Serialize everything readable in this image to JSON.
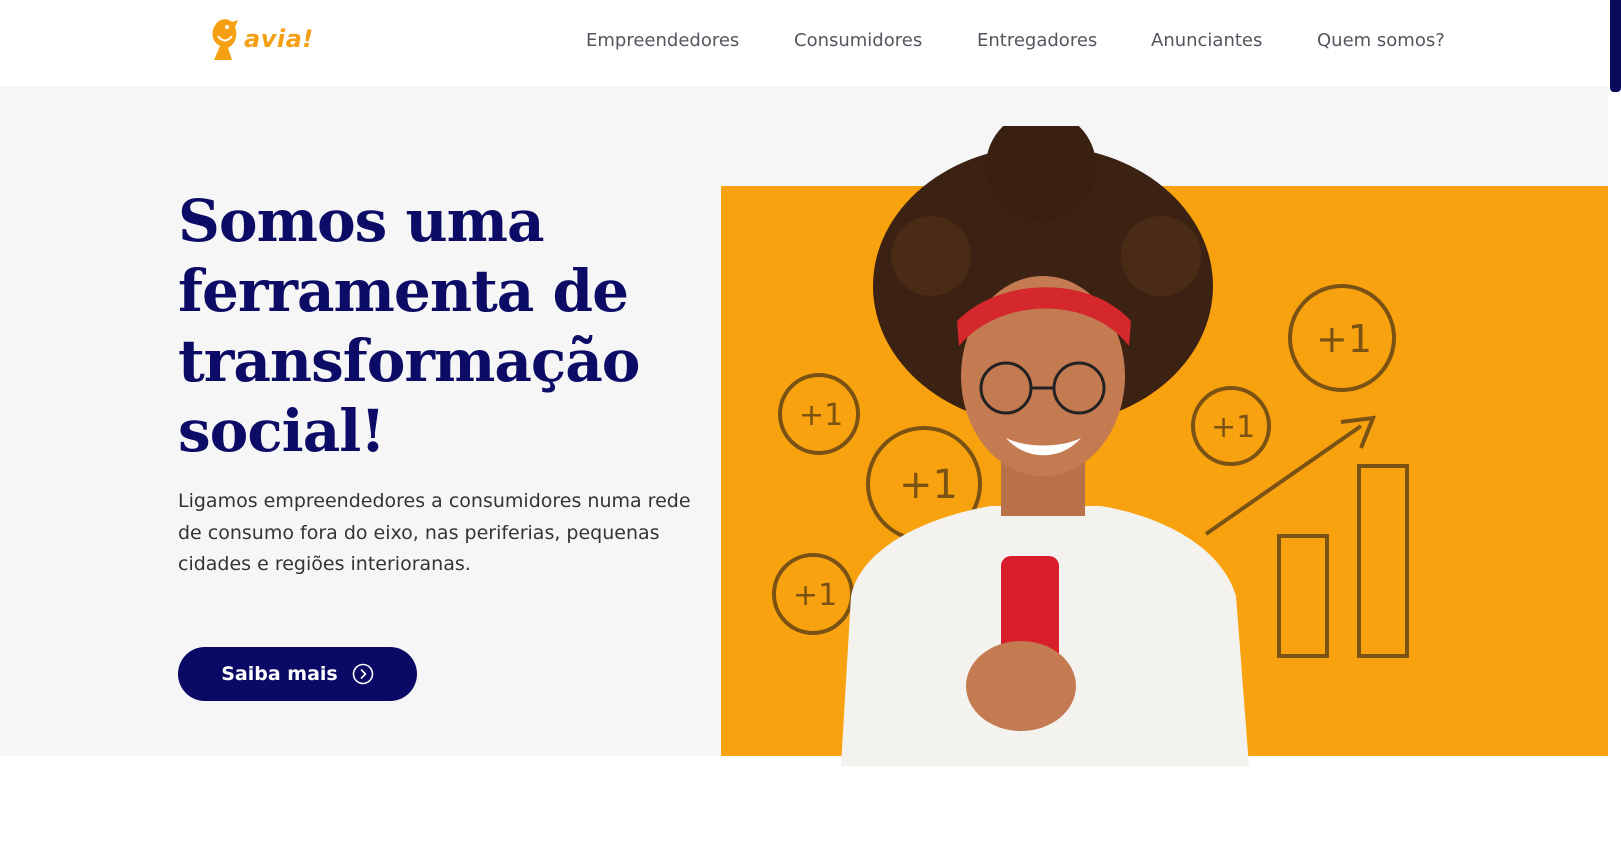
{
  "brand": {
    "logo_text": "avia!",
    "accent": "#f5a013",
    "primary": "#0a0a66"
  },
  "nav": {
    "items": [
      "Empreendedores",
      "Consumidores",
      "Entregadores",
      "Anunciantes",
      "Quem somos?"
    ]
  },
  "hero": {
    "headline": [
      "Somos uma",
      "ferramenta de",
      "transformação",
      "social!"
    ],
    "subtitle": "Ligamos empreendedores a consumidores numa rede de consumo fora do eixo, nas periferias, pequenas cidades e regiões interioranas.",
    "cta_label": "Saiba mais",
    "illustration_badge": "+1",
    "panel_color": "#f9a20f"
  }
}
